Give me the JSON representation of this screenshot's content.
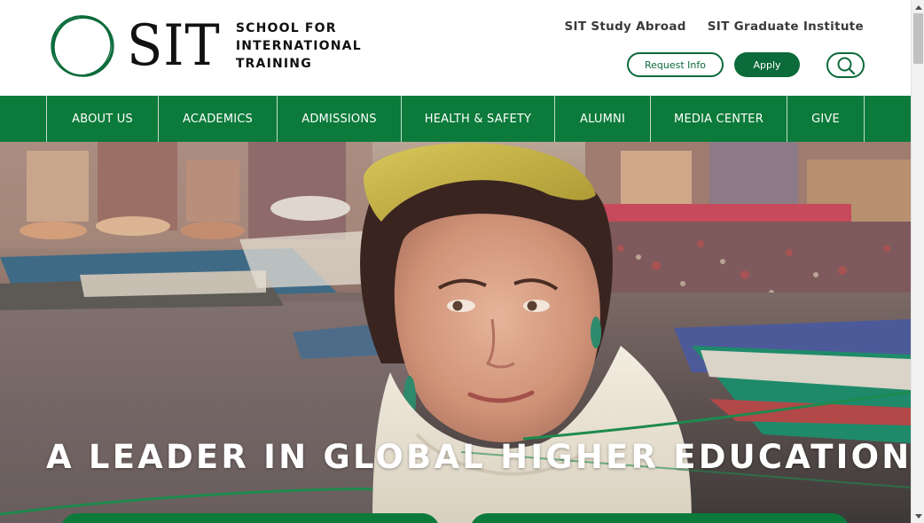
{
  "header": {
    "logo_letters": "SIT",
    "logo_lines": [
      "SCHOOL FOR",
      "INTERNATIONAL",
      "TRAINING"
    ],
    "toplinks": [
      "SIT Study Abroad",
      "SIT Graduate Institute"
    ],
    "request_info_label": "Request Info",
    "apply_label": "Apply",
    "search_icon": "search-icon"
  },
  "nav": {
    "items": [
      {
        "label": "ABOUT US"
      },
      {
        "label": "ACADEMICS"
      },
      {
        "label": "ADMISSIONS"
      },
      {
        "label": "HEALTH & SAFETY"
      },
      {
        "label": "ALUMNI"
      },
      {
        "label": "MEDIA CENTER"
      },
      {
        "label": "GIVE"
      }
    ]
  },
  "hero": {
    "title": "A LEADER IN GLOBAL HIGHER EDUCATION"
  },
  "colors": {
    "brand_green": "#0b7a3a",
    "brand_green_dark": "#0b6b3a"
  }
}
